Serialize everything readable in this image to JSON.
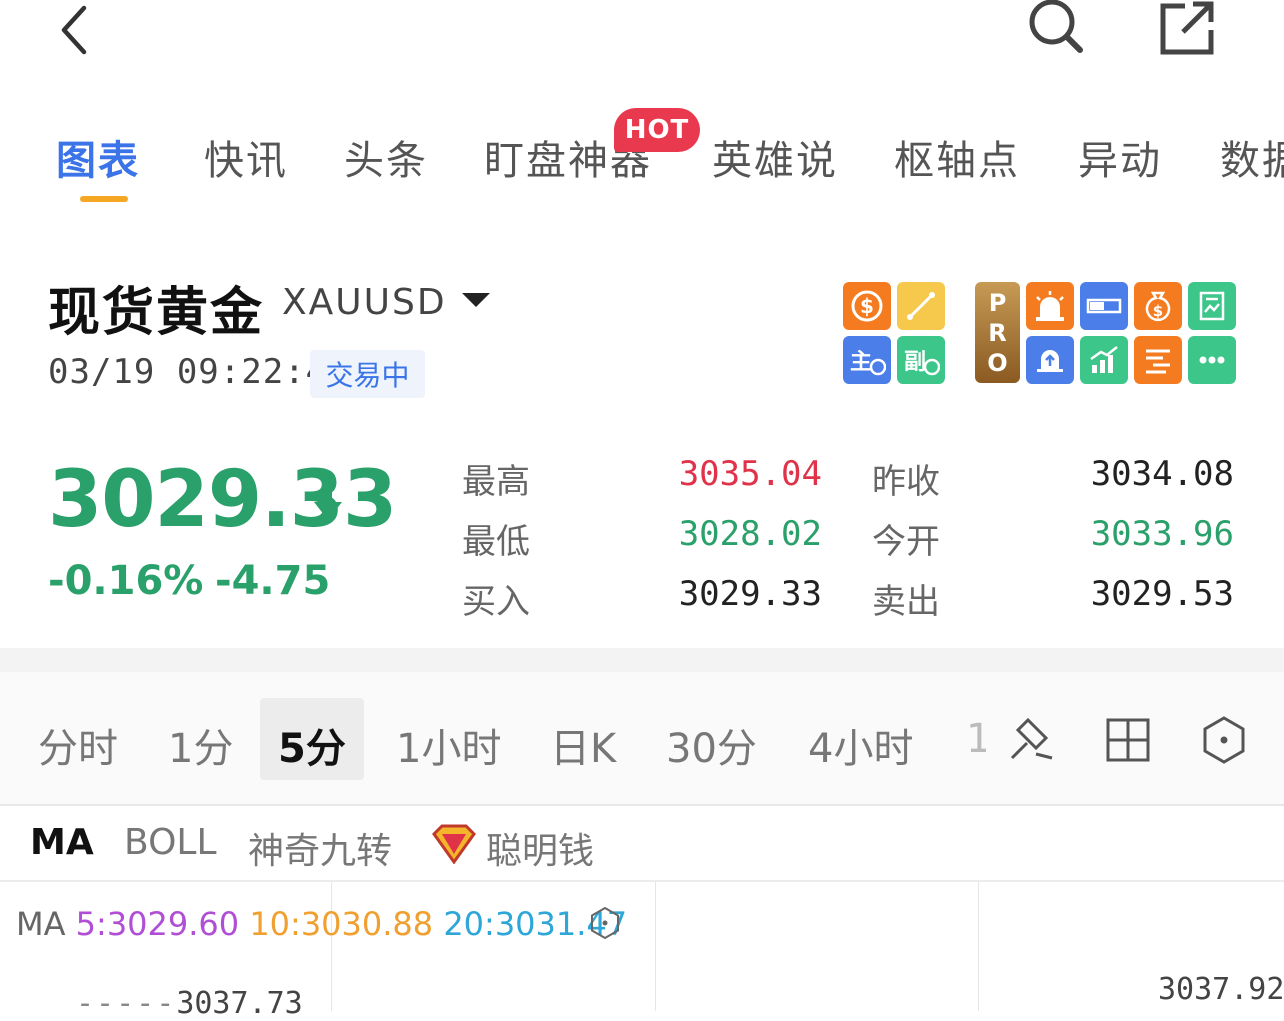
{
  "top_bar": {
    "back_icon": "chevron-left-icon",
    "search_icon": "search-icon",
    "share_icon": "external-link-icon"
  },
  "tabs": [
    {
      "label": "图表",
      "active": true
    },
    {
      "label": "快讯"
    },
    {
      "label": "头条"
    },
    {
      "label": "盯盘神器",
      "badge": "HOT"
    },
    {
      "label": "英雄说"
    },
    {
      "label": "枢轴点"
    },
    {
      "label": "异动"
    },
    {
      "label": "数据"
    }
  ],
  "instrument": {
    "name": "现货黄金",
    "symbol": "XAUUSD",
    "time": "03/19 09:22:42",
    "status": "交易中"
  },
  "tools": {
    "pro_label": "PRO",
    "left": [
      "dollar-icon",
      "ruler-icon",
      "main-force-icon",
      "sub-chart-icon"
    ],
    "right": [
      "alarm-icon",
      "ticket-icon",
      "coin-bag-icon",
      "report-icon",
      "bell-icon",
      "trend-icon",
      "bars-icon",
      "more-icon"
    ],
    "colors": {
      "orange": "#f57b20",
      "yellow": "#f6c94c",
      "blue": "#4b7ee8",
      "green": "#3cc68a"
    }
  },
  "quote": {
    "price": "3029.33",
    "change_pct": "-0.16%",
    "change": "-4.75",
    "stats": [
      {
        "label": "最高",
        "value": "3035.04",
        "color": "red"
      },
      {
        "label": "昨收",
        "value": "3034.08",
        "color": "dark"
      },
      {
        "label": "最低",
        "value": "3028.02",
        "color": "green"
      },
      {
        "label": "今开",
        "value": "3033.96",
        "color": "green"
      },
      {
        "label": "买入",
        "value": "3029.33",
        "color": "dark"
      },
      {
        "label": "卖出",
        "value": "3029.53",
        "color": "dark"
      }
    ]
  },
  "periods": {
    "items": [
      "分时",
      "1分",
      "5分",
      "1小时",
      "日K",
      "30分",
      "4小时",
      "1"
    ],
    "active": "5分"
  },
  "indicators": {
    "items": [
      "MA",
      "BOLL",
      "神奇九转",
      "聪明钱"
    ],
    "active": "MA"
  },
  "chart": {
    "ma_prefix": "MA",
    "ma5": "5:3029.60",
    "ma10": "10:3030.88",
    "ma20": "20:3031.47",
    "left_level": "3037.73",
    "right_level": "3037.92",
    "colors": {
      "ma5": "#b04fd6",
      "ma10": "#f0a030",
      "ma20": "#2ea6d8"
    }
  }
}
